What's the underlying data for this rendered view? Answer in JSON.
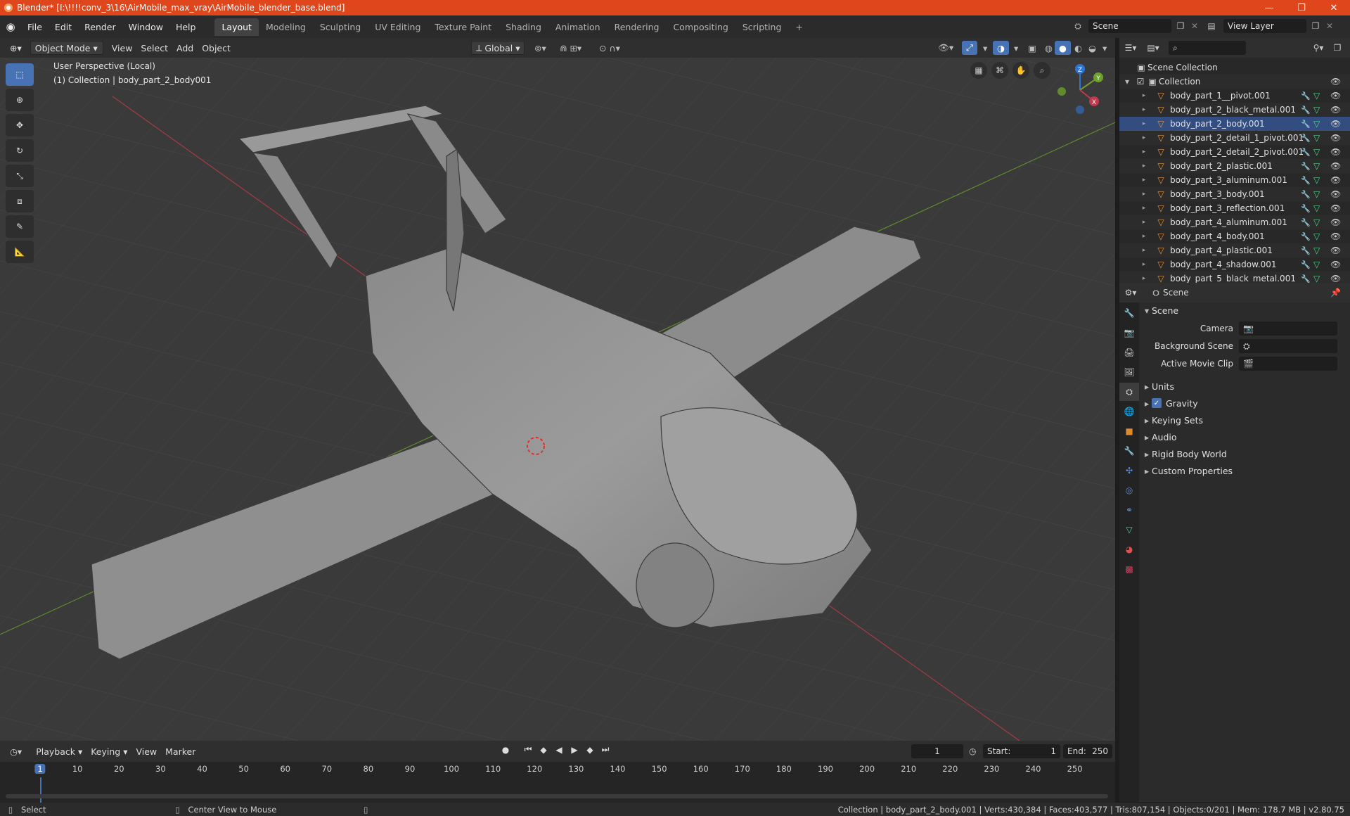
{
  "window": {
    "title": "Blender* [I:\\!!!!conv_3\\16\\AirMobile_max_vray\\AirMobile_blender_base.blend]",
    "minimize": "—",
    "maximize": "❐",
    "close": "✕"
  },
  "menu": {
    "items": [
      "File",
      "Edit",
      "Render",
      "Window",
      "Help"
    ],
    "workspaces": [
      "Layout",
      "Modeling",
      "Sculpting",
      "UV Editing",
      "Texture Paint",
      "Shading",
      "Animation",
      "Rendering",
      "Compositing",
      "Scripting"
    ],
    "active_workspace": "Layout",
    "add_tab": "+",
    "scene": "Scene",
    "view_layer": "View Layer"
  },
  "viewport_header": {
    "mode": "Object Mode",
    "menus": [
      "View",
      "Select",
      "Add",
      "Object"
    ],
    "orientation": "Global"
  },
  "viewport": {
    "perspective": "User Perspective (Local)",
    "collection_info": "(1) Collection | body_part_2_body001",
    "gizmo": {
      "z": "Z",
      "y": "Y",
      "x": "X"
    }
  },
  "outliner": {
    "search_placeholder": "",
    "root": "Scene Collection",
    "collection": "Collection",
    "items": [
      "body_part_1__pivot.001",
      "body_part_2_black_metal.001",
      "body_part_2_body.001",
      "body_part_2_detail_1_pivot.001",
      "body_part_2_detail_2_pivot.001",
      "body_part_2_plastic.001",
      "body_part_3_aluminum.001",
      "body_part_3_body.001",
      "body_part_3_reflection.001",
      "body_part_4_aluminum.001",
      "body_part_4_body.001",
      "body_part_4_plastic.001",
      "body_part_4_shadow.001",
      "body_part_5_black_metal.001"
    ],
    "selected_index": 2
  },
  "properties": {
    "context": "Scene",
    "panel": "Scene",
    "camera_label": "Camera",
    "bg_scene_label": "Background Scene",
    "movie_clip_label": "Active Movie Clip",
    "sections": [
      "Units",
      "Gravity",
      "Keying Sets",
      "Audio",
      "Rigid Body World",
      "Custom Properties"
    ],
    "gravity_checked": true
  },
  "timeline": {
    "menus": [
      "Playback",
      "Keying",
      "View",
      "Marker"
    ],
    "current_frame": "1",
    "start_label": "Start:",
    "start": "1",
    "end_label": "End:",
    "end": "250",
    "ticks": [
      "1",
      "10",
      "20",
      "30",
      "40",
      "50",
      "60",
      "70",
      "80",
      "90",
      "100",
      "110",
      "120",
      "130",
      "140",
      "150",
      "160",
      "170",
      "180",
      "190",
      "200",
      "210",
      "220",
      "230",
      "240",
      "250"
    ]
  },
  "status": {
    "select": "Select",
    "center_view": "Center View to Mouse",
    "stats": "Collection | body_part_2_body.001 | Verts:430,384 | Faces:403,577 | Tris:807,154 | Objects:0/201 | Mem: 178.7 MB | v2.80.75"
  },
  "colors": {
    "accent": "#4772b3",
    "titlebar": "#e0461c",
    "selection": "#334d80",
    "x_axis": "#c0394d",
    "y_axis": "#6da02c",
    "z_axis": "#2e74d4"
  }
}
